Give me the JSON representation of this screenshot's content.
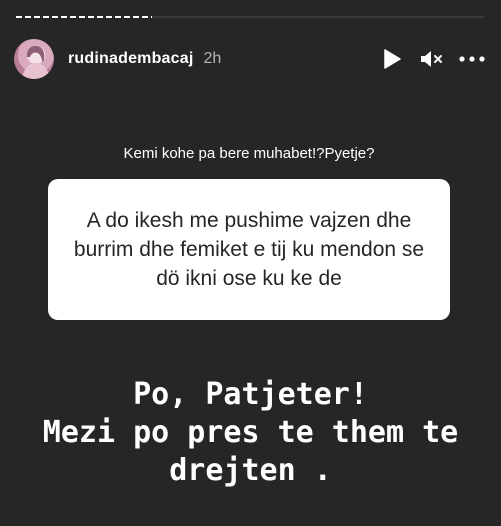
{
  "story": {
    "progress": 0.29,
    "username": "rudinadembacaj",
    "timestamp": "2h"
  },
  "controls": {
    "play_icon": "play-icon",
    "mute_icon": "mute-icon",
    "more_icon": "more-options-icon"
  },
  "question": {
    "prompt": "Kemi kohe pa bere muhabet!?Pyetje?",
    "answer": "A do ikesh me pushime vajzen dhe burrim dhe femiket e tij ku mendon se dö ikni ose ku ke de"
  },
  "reply": {
    "lines": [
      "Po, Patjeter!",
      "Mezi po pres te them te",
      "drejten ."
    ]
  },
  "colors": {
    "background": "#262626",
    "card": "#ffffff",
    "text": "#ffffff"
  }
}
